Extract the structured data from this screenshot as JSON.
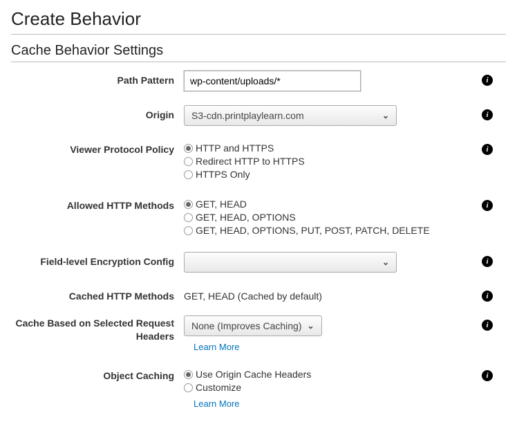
{
  "header": {
    "title": "Create Behavior"
  },
  "section": {
    "title": "Cache Behavior Settings"
  },
  "path_pattern": {
    "label": "Path Pattern",
    "value": "wp-content/uploads/*"
  },
  "origin": {
    "label": "Origin",
    "selected": "S3-cdn.printplaylearn.com"
  },
  "viewer_protocol": {
    "label": "Viewer Protocol Policy",
    "options": {
      "o1": "HTTP and HTTPS",
      "o2": "Redirect HTTP to HTTPS",
      "o3": "HTTPS Only"
    }
  },
  "allowed_methods": {
    "label": "Allowed HTTP Methods",
    "options": {
      "o1": "GET, HEAD",
      "o2": "GET, HEAD, OPTIONS",
      "o3": "GET, HEAD, OPTIONS, PUT, POST, PATCH, DELETE"
    }
  },
  "field_level_encryption": {
    "label": "Field-level Encryption Config",
    "selected": ""
  },
  "cached_methods": {
    "label": "Cached HTTP Methods",
    "value": "GET, HEAD (Cached by default)"
  },
  "cache_headers": {
    "label": "Cache Based on Selected Request Headers",
    "selected": "None (Improves Caching)",
    "learn_more": "Learn More"
  },
  "object_caching": {
    "label": "Object Caching",
    "options": {
      "o1": "Use Origin Cache Headers",
      "o2": "Customize"
    },
    "learn_more": "Learn More"
  },
  "info_glyph": "i"
}
